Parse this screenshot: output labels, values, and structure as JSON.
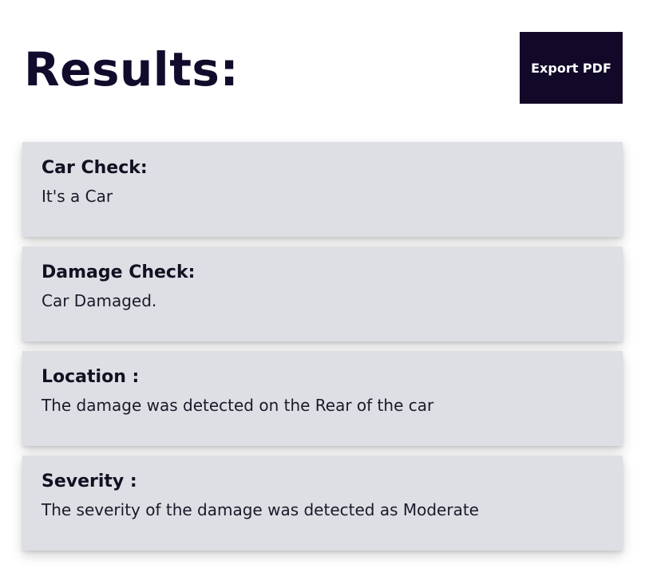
{
  "header": {
    "title": "Results:",
    "export_label": "Export PDF"
  },
  "results": [
    {
      "label": "Car Check:",
      "value": "It's a Car"
    },
    {
      "label": "Damage Check:",
      "value": "Car Damaged."
    },
    {
      "label": "Location :",
      "value": "The damage was detected on the Rear of the car"
    },
    {
      "label": "Severity :",
      "value": "The severity of the damage was detected as Moderate"
    }
  ],
  "colors": {
    "title": "#120b2c",
    "button_bg": "#120828",
    "button_text": "#ffffff",
    "card_bg": "#dddfe4"
  }
}
